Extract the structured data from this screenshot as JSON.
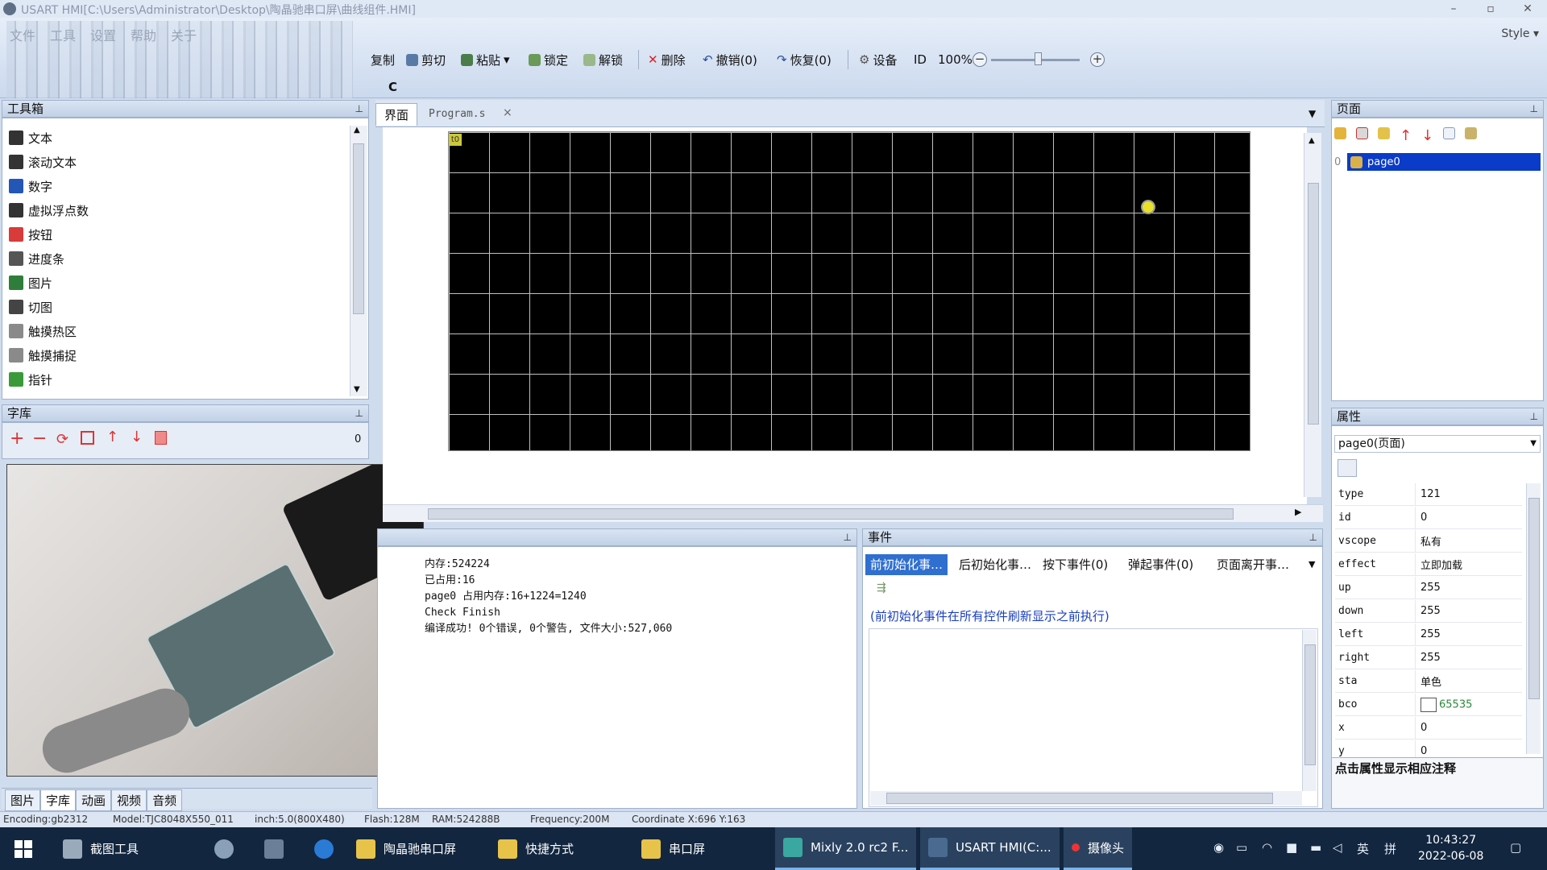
{
  "window": {
    "title": "USART HMI[C:\\Users\\Administrator\\Desktop\\陶晶驰串口屏\\曲线组件.HMI]",
    "minimize": "–",
    "maximize": "▫",
    "close": "✕"
  },
  "menu": [
    "文件",
    "工具",
    "设置",
    "帮助",
    "关于"
  ],
  "style_label": "Style ▾",
  "toolbar": {
    "copy": "复制",
    "cut": "剪切",
    "paste": "粘贴",
    "lock": "锁定",
    "unlock": "解锁",
    "delete": "删除",
    "undo": "撤销(0)",
    "redo": "恢复(0)",
    "device": "设备",
    "id": "ID",
    "zoom": "100%",
    "zoom_out": "−",
    "zoom_in": "+",
    "c_label": "C"
  },
  "toolbox": {
    "title": "工具箱",
    "items": [
      {
        "label": "文本",
        "icon": "text-icon",
        "color": "#333333"
      },
      {
        "label": "滚动文本",
        "icon": "scroll-text-icon",
        "color": "#333333"
      },
      {
        "label": "数字",
        "icon": "number-icon",
        "color": "#2456b8"
      },
      {
        "label": "虚拟浮点数",
        "icon": "float-icon",
        "color": "#333333"
      },
      {
        "label": "按钮",
        "icon": "button-icon",
        "color": "#d93a3a"
      },
      {
        "label": "进度条",
        "icon": "progress-bar-icon",
        "color": "#555555"
      },
      {
        "label": "图片",
        "icon": "picture-icon",
        "color": "#2f7d3b"
      },
      {
        "label": "切图",
        "icon": "crop-icon",
        "color": "#444444"
      },
      {
        "label": "触摸热区",
        "icon": "touch-area-icon",
        "color": "#8a8a8a"
      },
      {
        "label": "触摸捕捉",
        "icon": "touch-capture-icon",
        "color": "#8a8a8a"
      },
      {
        "label": "指针",
        "icon": "pointer-icon",
        "color": "#3a9a3a"
      }
    ]
  },
  "fontlib": {
    "title": "字库",
    "count": "0"
  },
  "bottom_tabs": [
    "图片",
    "字库",
    "动画",
    "视频",
    "音频"
  ],
  "editor": {
    "tab_design": "界面",
    "tab_program": "Program.s",
    "close": "×",
    "page_label": "t0"
  },
  "output": {
    "lines": [
      "内存:524224",
      "已占用:16",
      "page0 占用内存:16+1224=1240",
      "Check Finish",
      "编译成功! 0个错误, 0个警告, 文件大小:527,060"
    ]
  },
  "events": {
    "title": "事件",
    "tabs": [
      "前初始化事…",
      "后初始化事…",
      "按下事件(0)",
      "弹起事件(0)",
      "页面离开事…"
    ],
    "note": "(前初始化事件在所有控件刷新显示之前执行)"
  },
  "pages": {
    "title": "页面",
    "items": [
      {
        "index": "0",
        "name": "page0"
      }
    ]
  },
  "properties": {
    "title": "属性",
    "selected": "page0(页面)",
    "rows": [
      {
        "key": "type",
        "value": "121"
      },
      {
        "key": "id",
        "value": "0"
      },
      {
        "key": "vscope",
        "value": "私有"
      },
      {
        "key": "effect",
        "value": "立即加载"
      },
      {
        "key": "up",
        "value": "255"
      },
      {
        "key": "down",
        "value": "255"
      },
      {
        "key": "left",
        "value": "255"
      },
      {
        "key": "right",
        "value": "255"
      },
      {
        "key": "sta",
        "value": "单色"
      },
      {
        "key": "bco",
        "value": "65535"
      },
      {
        "key": "x",
        "value": "0"
      },
      {
        "key": "y",
        "value": "0"
      }
    ],
    "hint": "点击属性显示相应注释"
  },
  "status": {
    "encoding": "Encoding:gb2312",
    "model": "Model:TJC8048X550_011",
    "inch": "inch:5.0(800X480)",
    "flash": "Flash:128M",
    "ram": "RAM:524288B",
    "frequency": "Frequency:200M",
    "coordinate": "Coordinate X:696  Y:163"
  },
  "taskbar": {
    "items": [
      "截图工具",
      "陶晶驰串口屏",
      "快捷方式",
      "串口屏",
      "Mixly 2.0 rc2 F...",
      "USART HMI(C:...",
      "摄像头"
    ],
    "lang": "英",
    "ime": "拼",
    "time": "10:43:27",
    "date": "2022-06-08"
  },
  "colors": {
    "accent": "#0a3bc9",
    "canvas_bg": "#000000",
    "grid": "#c0c0c0"
  }
}
